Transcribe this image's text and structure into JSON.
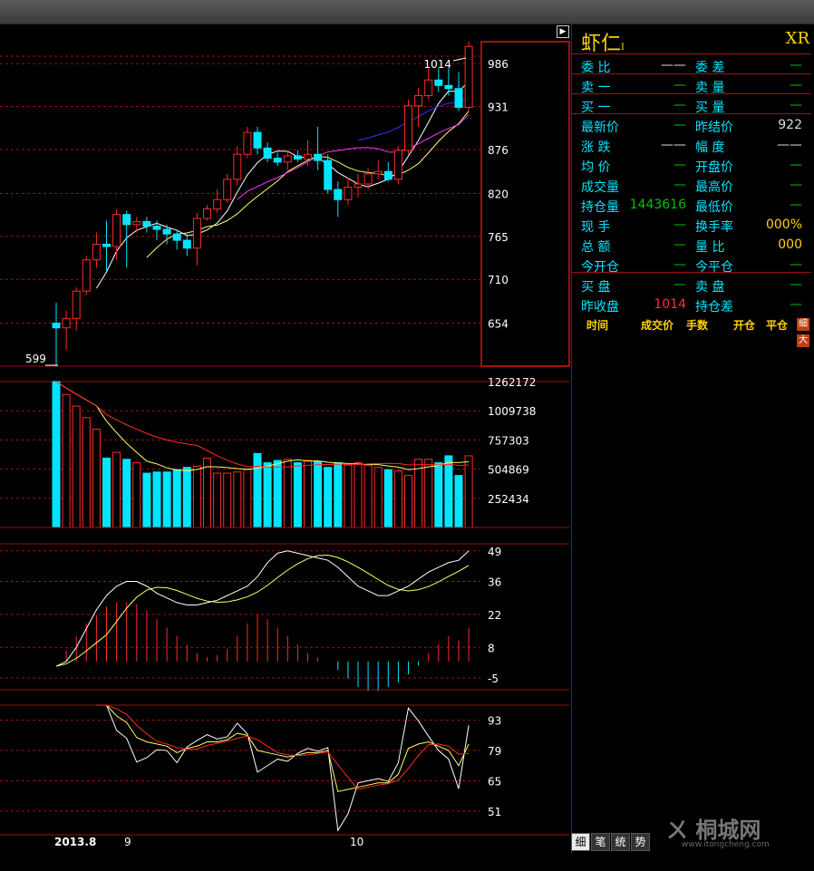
{
  "instrument": {
    "name": "虾仁",
    "suffix": "I",
    "flag": "XR"
  },
  "quote_rows": [
    {
      "l1": "委  比",
      "v1": "——",
      "l2": "委  差",
      "v2": "—"
    },
    {
      "l1": "卖  一",
      "v1": "—",
      "l2": "卖  量",
      "v2": "—"
    },
    {
      "l1": "买  一",
      "v1": "—",
      "l2": "买  量",
      "v2": "—"
    },
    {
      "l1": "最新价",
      "v1": "—",
      "l2": "昨结价",
      "v2": "922"
    },
    {
      "l1": "涨  跌",
      "v1": "——",
      "l2": "幅  度",
      "v2": "——"
    },
    {
      "l1": "均  价",
      "v1": "—",
      "l2": "开盘价",
      "v2": "—"
    },
    {
      "l1": "成交量",
      "v1": "—",
      "l2": "最高价",
      "v2": "—"
    },
    {
      "l1": "持仓量",
      "v1": "1443616",
      "l2": "最低价",
      "v2": "—"
    },
    {
      "l1": "现  手",
      "v1": "—",
      "l2": "换手率",
      "v2": "000%"
    },
    {
      "l1": "总  额",
      "v1": "—",
      "l2": "量  比",
      "v2": "000"
    },
    {
      "l1": "今开仓",
      "v1": "—",
      "l2": "今平仓",
      "v2": "—"
    },
    {
      "l1": "买  盘",
      "v1": "—",
      "l2": "卖  盘",
      "v2": "—"
    },
    {
      "l1": "昨收盘",
      "v1": "1014",
      "l2": "持仓差",
      "v2": "—"
    }
  ],
  "tick_headers": [
    "时间",
    "成交价",
    "手数",
    "开仓",
    "平仓"
  ],
  "side_buttons": [
    "細",
    "大"
  ],
  "bottom_tabs": [
    "细",
    "笔",
    "统",
    "势"
  ],
  "watermark": {
    "text": "桐城网",
    "url": "www.itongcheng.com"
  },
  "dates": {
    "d1": "2013.8",
    "d2": "9",
    "d3": "10"
  },
  "colors": {
    "up": "#ff2a2a",
    "down": "#00e5ff",
    "grid": "#a01010",
    "ma5": "#ffffff",
    "ma10": "#ffff66",
    "ma20": "#ff33ff",
    "ma60": "#3333ff"
  },
  "chart_data": [
    {
      "type": "candlestick",
      "ylim": [
        599,
        1014
      ],
      "yticks": [
        986,
        931,
        876,
        820,
        765,
        710,
        654
      ],
      "annotations": {
        "high": "1014",
        "low": "599"
      },
      "candles": [
        {
          "o": 654,
          "h": 680,
          "l": 599,
          "c": 648
        },
        {
          "o": 648,
          "h": 670,
          "l": 620,
          "c": 660
        },
        {
          "o": 660,
          "h": 700,
          "l": 645,
          "c": 695
        },
        {
          "o": 695,
          "h": 740,
          "l": 690,
          "c": 735
        },
        {
          "o": 735,
          "h": 770,
          "l": 725,
          "c": 755
        },
        {
          "o": 755,
          "h": 785,
          "l": 720,
          "c": 752
        },
        {
          "o": 752,
          "h": 800,
          "l": 735,
          "c": 793
        },
        {
          "o": 793,
          "h": 798,
          "l": 725,
          "c": 780
        },
        {
          "o": 780,
          "h": 790,
          "l": 770,
          "c": 784
        },
        {
          "o": 784,
          "h": 790,
          "l": 770,
          "c": 778
        },
        {
          "o": 778,
          "h": 785,
          "l": 760,
          "c": 774
        },
        {
          "o": 774,
          "h": 780,
          "l": 755,
          "c": 768
        },
        {
          "o": 768,
          "h": 772,
          "l": 748,
          "c": 760
        },
        {
          "o": 760,
          "h": 768,
          "l": 740,
          "c": 750
        },
        {
          "o": 750,
          "h": 795,
          "l": 728,
          "c": 788
        },
        {
          "o": 788,
          "h": 805,
          "l": 785,
          "c": 800
        },
        {
          "o": 800,
          "h": 825,
          "l": 795,
          "c": 812
        },
        {
          "o": 812,
          "h": 845,
          "l": 808,
          "c": 838
        },
        {
          "o": 838,
          "h": 880,
          "l": 830,
          "c": 870
        },
        {
          "o": 870,
          "h": 905,
          "l": 865,
          "c": 898
        },
        {
          "o": 898,
          "h": 905,
          "l": 870,
          "c": 878
        },
        {
          "o": 878,
          "h": 885,
          "l": 860,
          "c": 865
        },
        {
          "o": 865,
          "h": 872,
          "l": 855,
          "c": 860
        },
        {
          "o": 860,
          "h": 875,
          "l": 850,
          "c": 868
        },
        {
          "o": 868,
          "h": 875,
          "l": 860,
          "c": 864
        },
        {
          "o": 864,
          "h": 888,
          "l": 855,
          "c": 870
        },
        {
          "o": 870,
          "h": 905,
          "l": 850,
          "c": 862
        },
        {
          "o": 862,
          "h": 870,
          "l": 820,
          "c": 825
        },
        {
          "o": 825,
          "h": 835,
          "l": 790,
          "c": 812
        },
        {
          "o": 812,
          "h": 840,
          "l": 805,
          "c": 828
        },
        {
          "o": 828,
          "h": 845,
          "l": 815,
          "c": 832
        },
        {
          "o": 832,
          "h": 852,
          "l": 825,
          "c": 845
        },
        {
          "o": 845,
          "h": 862,
          "l": 838,
          "c": 848
        },
        {
          "o": 848,
          "h": 860,
          "l": 835,
          "c": 838
        },
        {
          "o": 838,
          "h": 880,
          "l": 832,
          "c": 875
        },
        {
          "o": 875,
          "h": 940,
          "l": 870,
          "c": 932
        },
        {
          "o": 932,
          "h": 955,
          "l": 905,
          "c": 945
        },
        {
          "o": 945,
          "h": 980,
          "l": 940,
          "c": 965
        },
        {
          "o": 965,
          "h": 980,
          "l": 950,
          "c": 958
        },
        {
          "o": 958,
          "h": 980,
          "l": 945,
          "c": 954
        },
        {
          "o": 954,
          "h": 975,
          "l": 925,
          "c": 930
        },
        {
          "o": 930,
          "h": 1014,
          "l": 925,
          "c": 1008
        }
      ]
    },
    {
      "type": "bar",
      "title": "volume",
      "yticks": [
        1262172,
        1009738,
        757303,
        504869,
        252434
      ],
      "values": [
        1262172,
        1150000,
        1050000,
        950000,
        850000,
        600000,
        650000,
        590000,
        560000,
        470000,
        480000,
        480000,
        500000,
        520000,
        530000,
        600000,
        470000,
        470000,
        480000,
        500000,
        640000,
        560000,
        580000,
        590000,
        560000,
        580000,
        570000,
        520000,
        560000,
        540000,
        560000,
        540000,
        520000,
        500000,
        490000,
        450000,
        590000,
        590000,
        560000,
        620000,
        450000,
        620000
      ]
    },
    {
      "type": "line",
      "title": "macd",
      "yticks": [
        49,
        36,
        22,
        8,
        -5
      ],
      "hist": [
        0,
        5,
        12,
        18,
        22,
        26,
        28,
        28,
        27,
        24,
        20,
        16,
        12,
        8,
        4,
        2,
        3,
        6,
        12,
        18,
        22,
        20,
        16,
        12,
        8,
        4,
        2,
        0,
        -4,
        -8,
        -12,
        -14,
        -14,
        -12,
        -10,
        -6,
        -2,
        4,
        8,
        12,
        10,
        16
      ]
    },
    {
      "type": "line",
      "title": "kdj",
      "yticks": [
        93,
        79,
        65,
        51
      ]
    }
  ]
}
